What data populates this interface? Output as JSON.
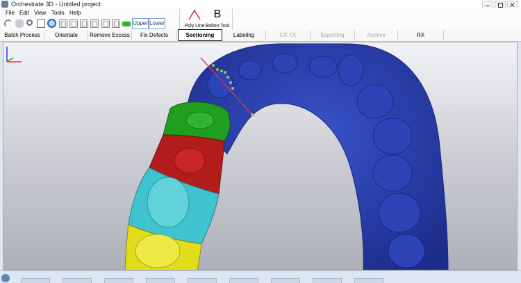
{
  "window": {
    "title": "Orchestrate 3D - Untitled project"
  },
  "menu": {
    "items": [
      "File",
      "Edit",
      "View",
      "Tools",
      "Help"
    ]
  },
  "toolbar": {
    "icons": [
      "undo-icon",
      "pan-hand-icon",
      "zoom-icon",
      "zoom-window-icon",
      "orbit-icon",
      "view-front-icon",
      "view-back-icon",
      "view-left-icon",
      "view-right-icon",
      "view-top-icon",
      "green-arch-icon"
    ],
    "upper_label": "Upper",
    "lower_label": "Lower",
    "poly_line_label": "Poly Line",
    "bolton_glyph": "B",
    "bolton_label": "Bolton Tool"
  },
  "tabs": [
    {
      "label": "Batch Process",
      "state": "normal"
    },
    {
      "label": "Orientate",
      "state": "normal"
    },
    {
      "label": "Remove Excess",
      "state": "normal"
    },
    {
      "label": "Fix Defects",
      "state": "normal"
    },
    {
      "label": "Sectioning",
      "state": "active"
    },
    {
      "label": "Labeling",
      "state": "normal"
    },
    {
      "label": "DX TX",
      "state": "disabled"
    },
    {
      "label": "Exporting",
      "state": "disabled"
    },
    {
      "label": "Archive",
      "state": "disabled"
    },
    {
      "label": "RX",
      "state": "normal"
    }
  ],
  "viewport": {
    "colors": {
      "arch": "#2438a8",
      "tooth_green": "#1f9e1f",
      "tooth_red": "#b41c1c",
      "tooth_cyan": "#3fc4cf",
      "tooth_yellow": "#e2dd1a",
      "section_line": "#d7364b",
      "section_points": "#8fcf38"
    }
  },
  "colors": {
    "active_tab_border": "#1b1b1b",
    "disabled_text": "#a9a9a9"
  }
}
